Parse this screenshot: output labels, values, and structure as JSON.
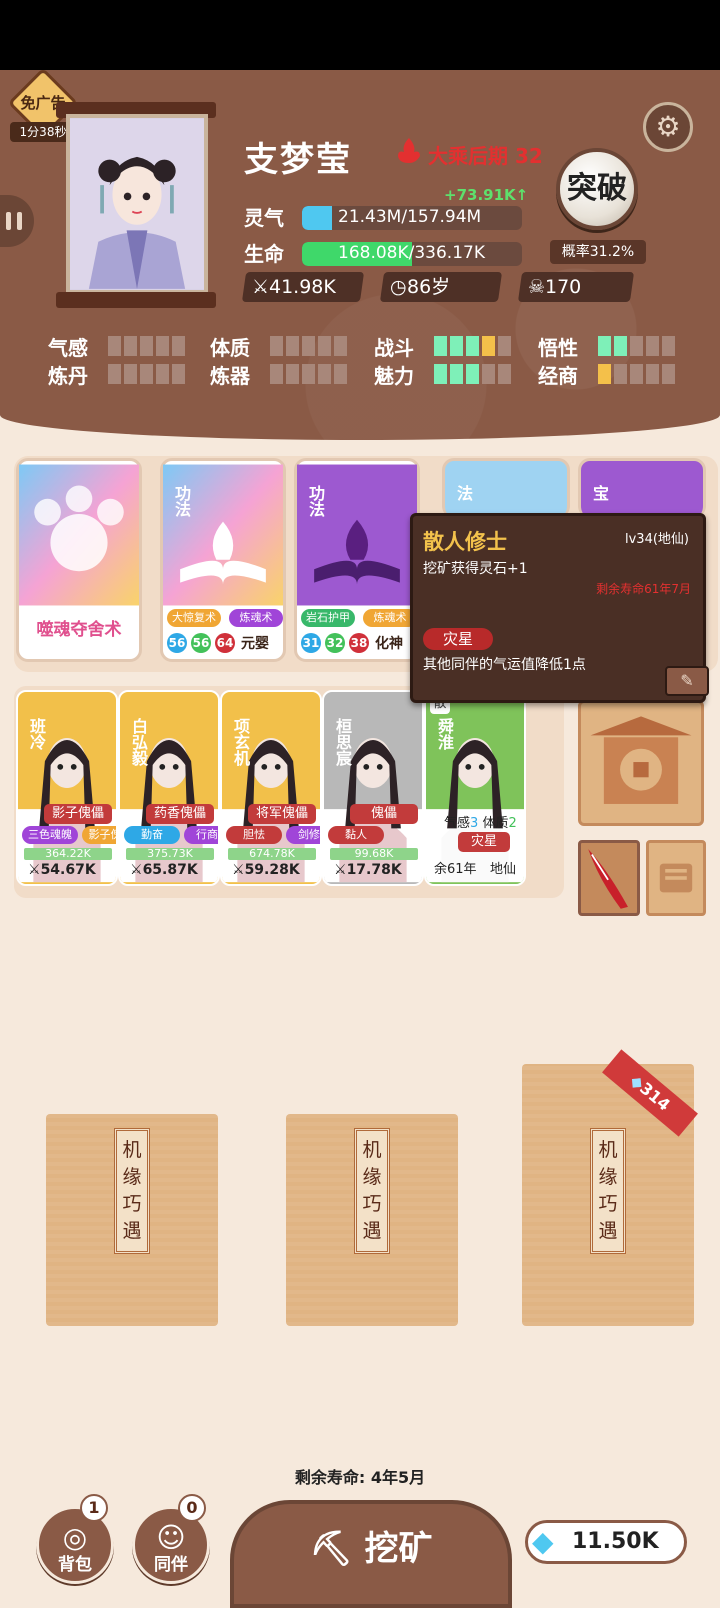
{
  "header": {
    "ad_badge": "免广告",
    "ad_timer": "1分38秒",
    "name": "支梦莹",
    "realm": "大乘后期 32",
    "qi_gain": "+73.91K↑",
    "qi_label": "灵气",
    "qi_value": "21.43M/157.94M",
    "qi_fill": 0.136,
    "hp_label": "生命",
    "hp_value": "168.08K/336.17K",
    "hp_fill": 0.5,
    "breakthrough_label": "突破",
    "breakthrough_rate": "概率31.2%",
    "power": "41.98K",
    "age": "86岁",
    "kills": "170",
    "icons": [
      "gear-icon",
      "pause-icon",
      "sword-icon",
      "clock-icon",
      "skull-icon"
    ]
  },
  "attributes": [
    {
      "label": "气感",
      "pips": [
        0,
        0,
        0,
        0,
        0
      ]
    },
    {
      "label": "体质",
      "pips": [
        0,
        0,
        0,
        0,
        0
      ]
    },
    {
      "label": "战斗",
      "pips": [
        1,
        1,
        1,
        2,
        0
      ]
    },
    {
      "label": "悟性",
      "pips": [
        1,
        1,
        0,
        0,
        0
      ]
    },
    {
      "label": "炼丹",
      "pips": [
        0,
        0,
        0,
        0,
        0
      ]
    },
    {
      "label": "炼器",
      "pips": [
        0,
        0,
        0,
        0,
        0
      ]
    },
    {
      "label": "魅力",
      "pips": [
        1,
        1,
        1,
        0,
        0
      ]
    },
    {
      "label": "经商",
      "pips": [
        2,
        0,
        0,
        0,
        0
      ]
    }
  ],
  "skills": [
    {
      "title": "噬魂夺舍术",
      "kind": "",
      "theme": "rainbow"
    },
    {
      "kind": "功法",
      "tag1": "大惊复术",
      "tag2": "炼魂术",
      "n1": "56",
      "n2": "56",
      "n3": "64",
      "rank": "元婴",
      "theme": "rainbow"
    },
    {
      "kind": "功法",
      "tag1": "岩石护甲",
      "tag2": "炼魂术",
      "n1": "31",
      "n2": "32",
      "n3": "38",
      "rank": "化神",
      "theme": "purple"
    },
    {
      "kind": "法",
      "theme": "blue"
    },
    {
      "kind": "宝",
      "theme": "purple"
    }
  ],
  "companions": [
    {
      "name": "班冷",
      "role": "影子傀儡",
      "trait1": "三色魂魄",
      "trait2": "影子傀",
      "hp": "364.22K",
      "power": "54.67K",
      "theme": "gold"
    },
    {
      "name": "白弘毅",
      "role": "药香傀儡",
      "trait1": "勤奋",
      "trait2": "行商",
      "hp": "375.73K",
      "power": "65.87K",
      "theme": "gold"
    },
    {
      "name": "项玄机",
      "role": "将军傀儡",
      "trait1": "胆怯",
      "trait2": "剑修",
      "hp": "674.78K",
      "power": "59.28K",
      "theme": "gold"
    },
    {
      "name": "桓思宸",
      "role": "傀儡",
      "trait1": "黏人",
      "trait2": "",
      "hp": "99.68K",
      "power": "17.78K",
      "theme": "gray"
    },
    {
      "name": "舜淮",
      "badge": "散",
      "attr1": "气感",
      "attr1v": "3",
      "attr2": "体质",
      "attr2v": "2",
      "role": "灾星",
      "life": "余61年",
      "rank": "地仙",
      "theme": "green"
    }
  ],
  "tooltip": {
    "title": "散人修士",
    "level": "lv34(地仙)",
    "effect": "挖矿获得灵石+1",
    "lifespan": "剩余寿命61年7月",
    "trait": "灾星",
    "trait_desc": "其他同伴的气运值降低1点"
  },
  "packets": [
    {
      "label": "机缘巧遇"
    },
    {
      "label": "机缘巧遇"
    },
    {
      "label": "机缘巧遇",
      "cost": "314"
    }
  ],
  "footer": {
    "lifespan": "剩余寿命: 4年5月",
    "bag_label": "背包",
    "bag_count": "1",
    "companion_label": "同伴",
    "companion_count": "0",
    "mine_label": "挖矿",
    "gems": "11.50K"
  }
}
